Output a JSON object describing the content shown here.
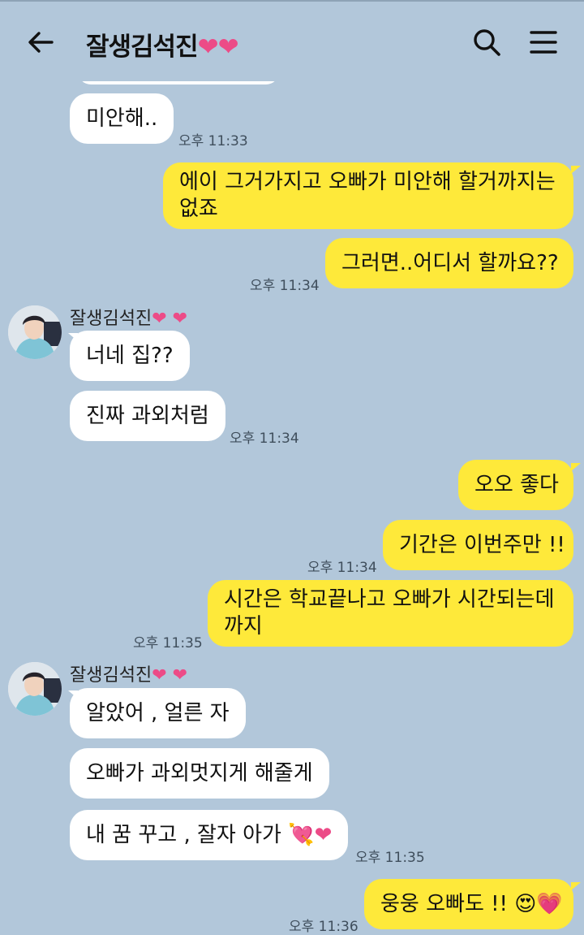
{
  "header": {
    "title": "잘생김석진",
    "title_hearts": "❤❤"
  },
  "contact": {
    "name": "잘생김석진",
    "hearts": "❤ ❤"
  },
  "messages": [
    {
      "side": "in",
      "text": "미안해..",
      "time": ""
    },
    {
      "side": "in",
      "text": "",
      "time": "오후 11:33"
    },
    {
      "side": "out",
      "text": "에이 그거가지고 오빠가 미안해 할거까지는 없죠"
    },
    {
      "side": "out",
      "text": "그러면..어디서 할까요??",
      "time": "오후 11:34"
    },
    {
      "side": "in",
      "text": "너네 집??"
    },
    {
      "side": "in",
      "text": "진짜 과외처럼",
      "time": "오후 11:34"
    },
    {
      "side": "out",
      "text": "오오 좋다"
    },
    {
      "side": "out",
      "text": "기간은 이번주만 !!",
      "time": "오후 11:34"
    },
    {
      "side": "out",
      "text": "시간은 학교끝나고 오빠가 시간되는데 까지",
      "time": "오후 11:35"
    },
    {
      "side": "in",
      "text": "알았어 , 얼른 자"
    },
    {
      "side": "in",
      "text": "오빠가 과외멋지게 해줄게"
    },
    {
      "side": "in",
      "text": "내 꿈 꾸고 , 잘자 아가",
      "emoji": "💘❤",
      "time": "오후 11:35"
    },
    {
      "side": "out",
      "text": "웅웅 오빠도 !!",
      "emoji": "😍💗",
      "time": "오후 11:36"
    }
  ],
  "colors": {
    "background": "#b2c7da",
    "outgoing_bubble": "#fee93a",
    "incoming_bubble": "#ffffff",
    "heart": "#ec4b87"
  },
  "icons": {
    "back": "back-arrow-icon",
    "search": "search-icon",
    "menu": "hamburger-menu-icon"
  }
}
